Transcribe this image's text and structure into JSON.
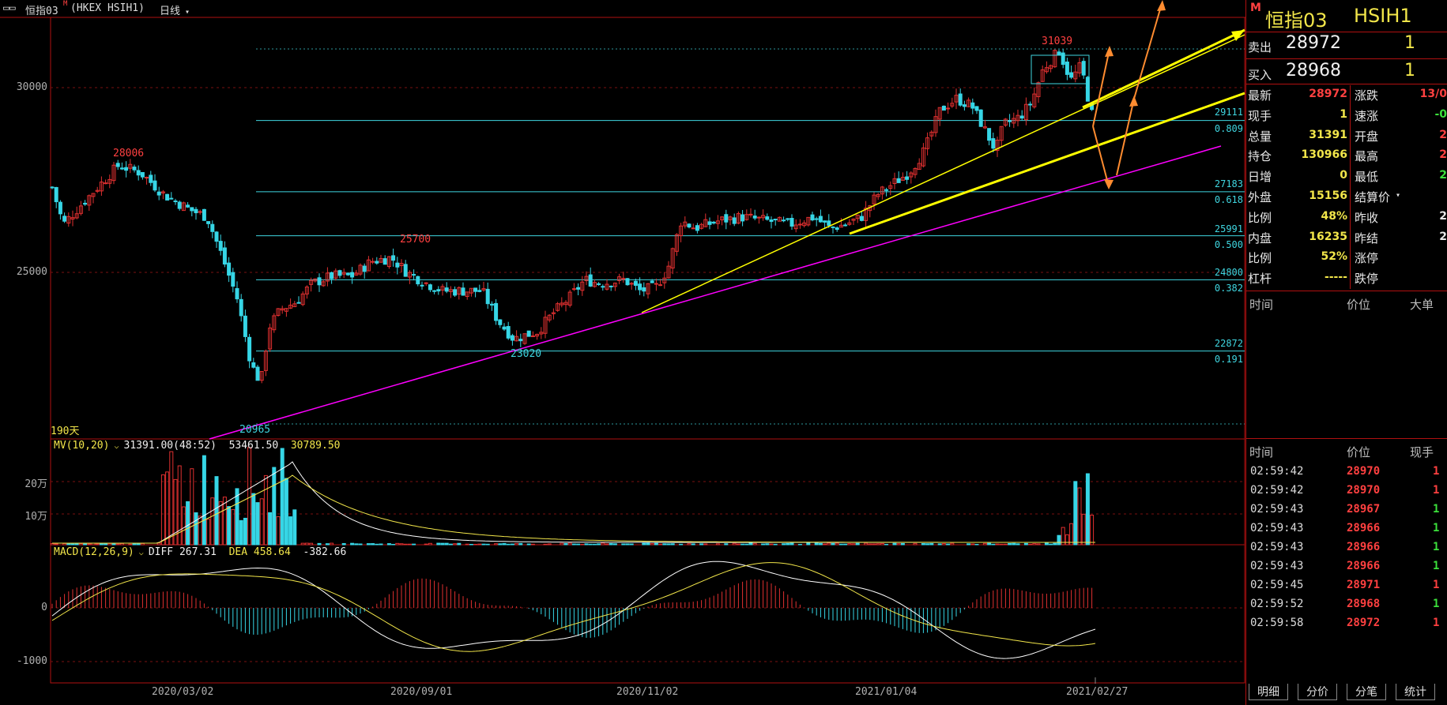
{
  "window": {
    "title": "恒指03",
    "title_sup": "M",
    "instrument": "(HKEX HSIH1)",
    "period": "日线"
  },
  "price_axis": {
    "ticks": [
      "30000",
      "25000"
    ]
  },
  "date_axis": {
    "ticks": [
      "2020/03/02",
      "2020/09/01",
      "2020/11/02",
      "2021/01/04",
      "2021/02/27"
    ]
  },
  "annotations": {
    "high_28006": "28006",
    "high_25700": "25700",
    "high_31039": "31039",
    "low_23020": "23020",
    "low_20965": "20965",
    "days": "190天"
  },
  "fib_levels": [
    {
      "price": "29111",
      "ratio": "0.809"
    },
    {
      "price": "27183",
      "ratio": "0.618"
    },
    {
      "price": "25991",
      "ratio": "0.500"
    },
    {
      "price": "24800",
      "ratio": "0.382"
    },
    {
      "price": "22872",
      "ratio": "0.191"
    }
  ],
  "volume_panel": {
    "label": "MV(10,20)",
    "v1": "31391.00(48:52)",
    "v2": "53461.50",
    "v3": "30789.50",
    "ticks": [
      "20万",
      "10万"
    ]
  },
  "macd_panel": {
    "label": "MACD(12,26,9)",
    "diff": "DIFF 267.31",
    "dea": "DEA 458.64",
    "macd": "-382.66",
    "ticks": [
      "0",
      "-1000"
    ]
  },
  "quote_panel": {
    "m_badge": "M",
    "name": "恒指03",
    "code": "HSIH1",
    "ask_label": "卖出",
    "ask_price": "28972",
    "ask_vol": "1",
    "bid_label": "买入",
    "bid_price": "28968",
    "bid_vol": "1",
    "stats_left": [
      {
        "label": "最新",
        "value": "28972",
        "color": "#ff4040"
      },
      {
        "label": "现手",
        "value": "1",
        "color": "#f2e64a"
      },
      {
        "label": "总量",
        "value": "31391",
        "color": "#f2e64a"
      },
      {
        "label": "持仓",
        "value": "130966",
        "color": "#f2e64a"
      },
      {
        "label": "日增",
        "value": "0",
        "color": "#f2e64a"
      },
      {
        "label": "外盘",
        "value": "15156",
        "color": "#f2e64a"
      },
      {
        "label": "比例",
        "value": "48%",
        "color": "#f2e64a"
      },
      {
        "label": "内盘",
        "value": "16235",
        "color": "#f2e64a"
      },
      {
        "label": "比例",
        "value": "52%",
        "color": "#f2e64a"
      },
      {
        "label": "杠杆",
        "value": "-----",
        "color": "#f2e64a"
      }
    ],
    "stats_right": [
      {
        "label": "涨跌",
        "value": "13/0",
        "color": "#ff4040"
      },
      {
        "label": "速涨",
        "value": "-0",
        "color": "#3be03b"
      },
      {
        "label": "开盘",
        "value": "2",
        "color": "#ff4040"
      },
      {
        "label": "最高",
        "value": "2",
        "color": "#ff4040"
      },
      {
        "label": "最低",
        "value": "2",
        "color": "#3be03b"
      },
      {
        "label": "结算价",
        "value": "",
        "color": "#e8e8e8"
      },
      {
        "label": "昨收",
        "value": "2",
        "color": "#e8e8e8"
      },
      {
        "label": "昨结",
        "value": "2",
        "color": "#e8e8e8"
      },
      {
        "label": "涨停",
        "value": "",
        "color": "#e8e8e8"
      },
      {
        "label": "跌停",
        "value": "",
        "color": "#e8e8e8"
      }
    ],
    "list1_headers": [
      "时间",
      "价位",
      "大单"
    ],
    "list2_headers": [
      "时间",
      "价位",
      "现手"
    ],
    "ticks": [
      {
        "time": "02:59:42",
        "price": "28970",
        "vol": "1",
        "vol_color": "#ff4040"
      },
      {
        "time": "02:59:42",
        "price": "28970",
        "vol": "1",
        "vol_color": "#ff4040"
      },
      {
        "time": "02:59:43",
        "price": "28967",
        "vol": "1",
        "vol_color": "#3be03b"
      },
      {
        "time": "02:59:43",
        "price": "28966",
        "vol": "1",
        "vol_color": "#3be03b"
      },
      {
        "time": "02:59:43",
        "price": "28966",
        "vol": "1",
        "vol_color": "#3be03b"
      },
      {
        "time": "02:59:43",
        "price": "28966",
        "vol": "1",
        "vol_color": "#3be03b"
      },
      {
        "time": "02:59:45",
        "price": "28971",
        "vol": "1",
        "vol_color": "#ff4040"
      },
      {
        "time": "02:59:52",
        "price": "28968",
        "vol": "1",
        "vol_color": "#3be03b"
      },
      {
        "time": "02:59:58",
        "price": "28972",
        "vol": "1",
        "vol_color": "#ff4040"
      }
    ],
    "tabs": [
      "明细",
      "分价",
      "分笔",
      "统计"
    ]
  },
  "colors": {
    "up": "#e03030",
    "down": "#36d6e6",
    "fib": "#3fd6e0",
    "trend": "#ffff00",
    "support": "#ff00ff",
    "forecast": "#ff8c30",
    "frame": "#b01010"
  }
}
